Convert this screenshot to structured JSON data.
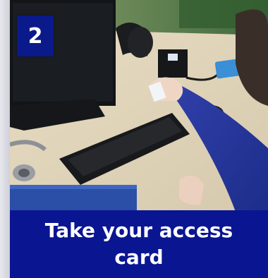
{
  "step": {
    "number": "2",
    "badge_color": "#0b1a8a"
  },
  "caption": {
    "text": "Take your access card",
    "background_color": "#0a1592",
    "text_color": "#ffffff"
  },
  "photo": {
    "subject": "hand-on-card-reader-photo"
  }
}
